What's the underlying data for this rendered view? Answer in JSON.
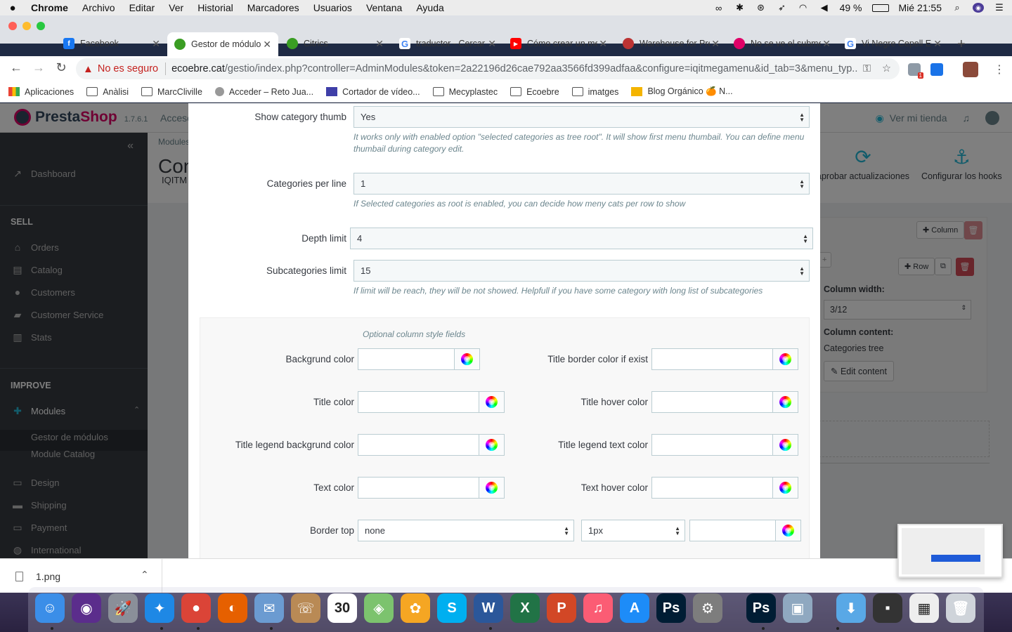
{
  "menubar": {
    "app": "Chrome",
    "items": [
      "Archivo",
      "Editar",
      "Ver",
      "Historial",
      "Marcadores",
      "Usuarios",
      "Ventana",
      "Ayuda"
    ],
    "battery": "49 %",
    "clock": "Mié 21:55"
  },
  "tabs": [
    {
      "title": "Facebook",
      "color": "#1877f2",
      "glyph": "f"
    },
    {
      "title": "Gestor de módulos",
      "color": "#df0067",
      "glyph": "",
      "active": true
    },
    {
      "title": "Citrics",
      "color": "#3a9d23",
      "glyph": ""
    },
    {
      "title": "traductor - Cercar",
      "color": "#4285f4",
      "glyph": "G"
    },
    {
      "title": "Cómo crear un menú",
      "color": "#ff0000",
      "glyph": "▶"
    },
    {
      "title": "Warehouse for Presta",
      "color": "#b33",
      "glyph": ""
    },
    {
      "title": "No se ve el submenú",
      "color": "#df0067",
      "glyph": ""
    },
    {
      "title": "Vi Negre Cepell Eco",
      "color": "#4285f4",
      "glyph": "G"
    }
  ],
  "omnibox": {
    "not_secure": "No es seguro",
    "host": "ecoebre.cat",
    "path": "/gestio/index.php?controller=AdminModules&token=2a22196d26cae792aa3566fd399adfaa&configure=iqitmegamenu&id_tab=3&menu_typ..."
  },
  "bookmarks": [
    "Aplicaciones",
    "Anàlisi",
    "MarcCliville",
    "Acceder – Reto Jua...",
    "Cortador de vídeo...",
    "Mecyplastec",
    "Ecoebre",
    "imatges",
    "Blog Orgánico 🍊 N..."
  ],
  "prestashop": {
    "logo_a": "Presta",
    "logo_b": "Shop",
    "version": "1.7.6.1",
    "access": "Acceso",
    "view_store": "Ver mi tienda",
    "breadcrumb": "Modules",
    "title": "Con",
    "subtitle": "IQITM",
    "actions": [
      "aprobar actualizaciones",
      "Configurar los hooks"
    ]
  },
  "sidebar": {
    "dashboard": "Dashboard",
    "sell_title": "SELL",
    "sell": [
      "Orders",
      "Catalog",
      "Customers",
      "Customer Service",
      "Stats"
    ],
    "improve_title": "IMPROVE",
    "modules": "Modules",
    "modules_sub": [
      "Gestor de módulos",
      "Module Catalog"
    ],
    "more": [
      "Design",
      "Shipping",
      "Payment",
      "International"
    ]
  },
  "right_panel": {
    "column_btn": "Column",
    "row_btn": "Row",
    "width_label": "Column width:",
    "width_value": "3/12",
    "content_label": "Column content:",
    "content_value": "Categories tree",
    "edit_btn": "Edit content"
  },
  "form": {
    "show_thumb_label": "Show category thumb",
    "show_thumb_value": "Yes",
    "show_thumb_help": "It works only with enabled option \"selected categories as tree root\". It will show first menu thumbail. You can define menu thumbail during category edit.",
    "per_line_label": "Categories per line",
    "per_line_value": "1",
    "per_line_help": "If Selected categories as root is enabled, you can decide how meny cats per row to show",
    "depth_label": "Depth limit",
    "depth_value": "4",
    "subcat_label": "Subcategories limit",
    "subcat_value": "15",
    "subcat_help": "If limit will be reach, they will be not showed. Helpfull if you have some category with long list of subcategories",
    "style_legend": "Optional column style fields",
    "bg_color": "Backgrund color",
    "title_border": "Title border color if exist",
    "title_color": "Title color",
    "title_hover": "Title hover color",
    "legend_bg": "Title legend backgrund color",
    "legend_text": "Title legend text color",
    "text_color": "Text color",
    "text_hover": "Text hover color",
    "border_top": "Border top",
    "border_style": "none",
    "border_width": "1px"
  },
  "downloads": {
    "file": "1.png"
  },
  "dock": [
    {
      "name": "finder-icon",
      "color": "#3b8ee8",
      "glyph": "☺"
    },
    {
      "name": "siri-icon",
      "color": "#5b2d8c",
      "glyph": "◉"
    },
    {
      "name": "launchpad-icon",
      "color": "#8a8f99",
      "glyph": "🚀"
    },
    {
      "name": "safari-icon",
      "color": "#1e88e5",
      "glyph": "✦"
    },
    {
      "name": "chrome-icon",
      "color": "#db4437",
      "glyph": "●"
    },
    {
      "name": "firefox-icon",
      "color": "#e66000",
      "glyph": "◐"
    },
    {
      "name": "mail-icon",
      "color": "#6b9bd1",
      "glyph": "✉"
    },
    {
      "name": "contacts-icon",
      "color": "#b98a55",
      "glyph": "☏"
    },
    {
      "name": "calendar-icon",
      "color": "#ffffff",
      "glyph": "30"
    },
    {
      "name": "maps-icon",
      "color": "#7cc36e",
      "glyph": "◈"
    },
    {
      "name": "photos-icon",
      "color": "#f5a623",
      "glyph": "✿"
    },
    {
      "name": "skype-icon",
      "color": "#00aff0",
      "glyph": "S"
    },
    {
      "name": "word-icon",
      "color": "#2b579a",
      "glyph": "W"
    },
    {
      "name": "excel-icon",
      "color": "#217346",
      "glyph": "X"
    },
    {
      "name": "powerpoint-icon",
      "color": "#d24726",
      "glyph": "P"
    },
    {
      "name": "music-icon",
      "color": "#fb5c74",
      "glyph": "♫"
    },
    {
      "name": "appstore-icon",
      "color": "#1d8cf8",
      "glyph": "A"
    },
    {
      "name": "photoshop-icon",
      "color": "#001d34",
      "glyph": "Ps"
    },
    {
      "name": "preferences-icon",
      "color": "#7d7d7d",
      "glyph": "⚙"
    },
    {
      "name": "photoshop2-icon",
      "color": "#001d34",
      "glyph": "Ps"
    },
    {
      "name": "preview-icon",
      "color": "#8fa8c0",
      "glyph": "▣"
    },
    {
      "name": "downloads-folder-icon",
      "color": "#59a8e6",
      "glyph": "⬇"
    },
    {
      "name": "stack-icon",
      "color": "#333333",
      "glyph": "▪"
    },
    {
      "name": "grid-stack-icon",
      "color": "#eeeeee",
      "glyph": "▦"
    },
    {
      "name": "trash-icon",
      "color": "#cfd4da",
      "glyph": "🗑"
    }
  ]
}
